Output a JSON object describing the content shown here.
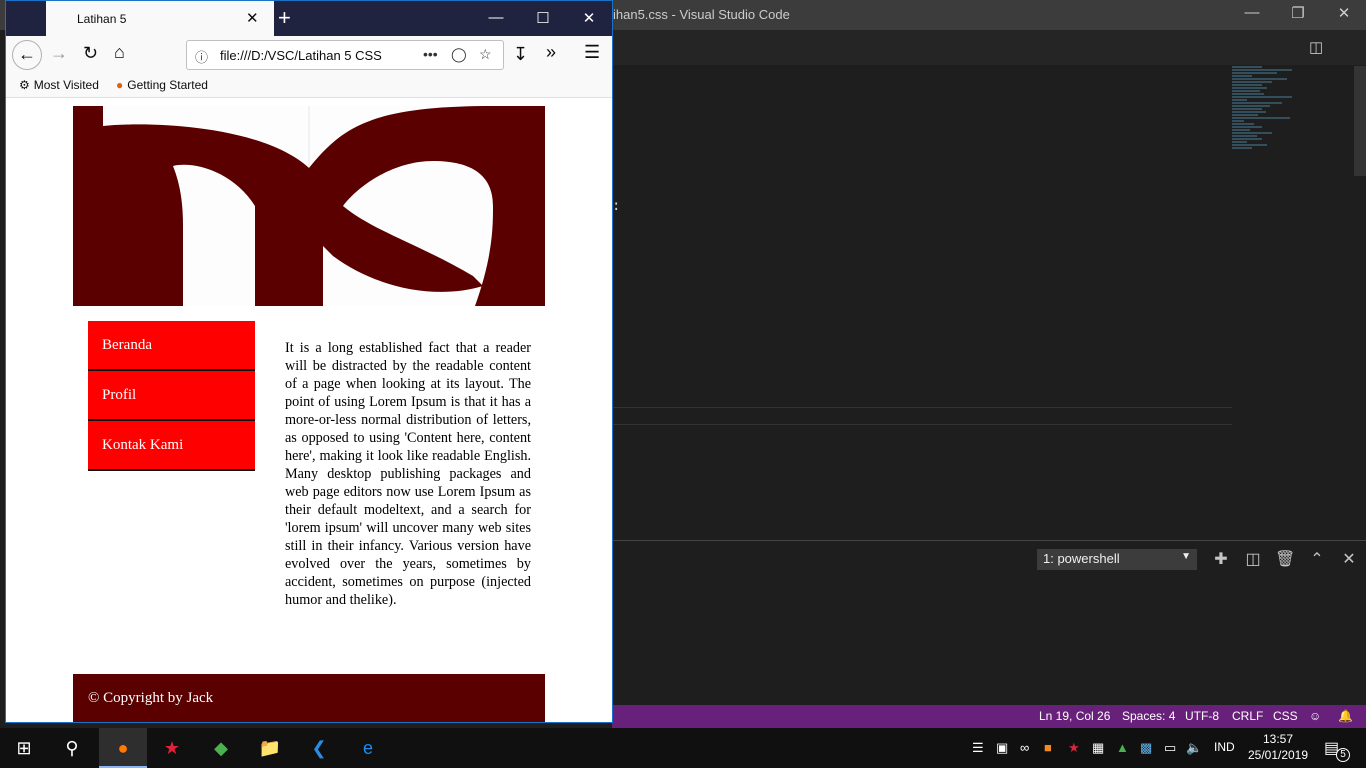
{
  "vscode": {
    "title": "ihan5.css - Visual Studio Code",
    "stray_text": ":",
    "terminal_select": "1: powershell",
    "status": {
      "position": "Ln 19, Col 26",
      "spaces": "Spaces: 4",
      "encoding": "UTF-8",
      "eol": "CRLF",
      "language": "CSS"
    }
  },
  "firefox": {
    "tab_title": "Latihan 5",
    "url": "file:///D:/VSC/Latihan 5 CSS",
    "bookmarks": [
      "Most Visited",
      "Getting Started"
    ]
  },
  "page": {
    "nav": [
      "Beranda",
      "Profil",
      "Kontak Kami"
    ],
    "article": "It is a long established fact that a reader will be distracted by the readable content of a page when looking at its layout. The point of using Lorem Ipsum is that it has a more-or-less normal distribution of letters, as opposed to using 'Content here, content here', making it look like readable English. Many desktop publishing packages and web page editors now use Lorem Ipsum as their default modeltext, and a search for 'lorem ipsum' will uncover many web sites still in their infancy. Various version have evolved over the years, sometimes by accident, sometimes on purpose (injected humor and thelike).",
    "footer": "© Copyright by Jack"
  },
  "taskbar": {
    "language": "IND",
    "time": "13:57",
    "date": "25/01/2019",
    "notification_count": "5"
  },
  "colors": {
    "nav_bg": "#ff0000",
    "banner_brand": "#5a0000",
    "footer_bg": "#5a0000",
    "vscode_status": "#68217a"
  }
}
